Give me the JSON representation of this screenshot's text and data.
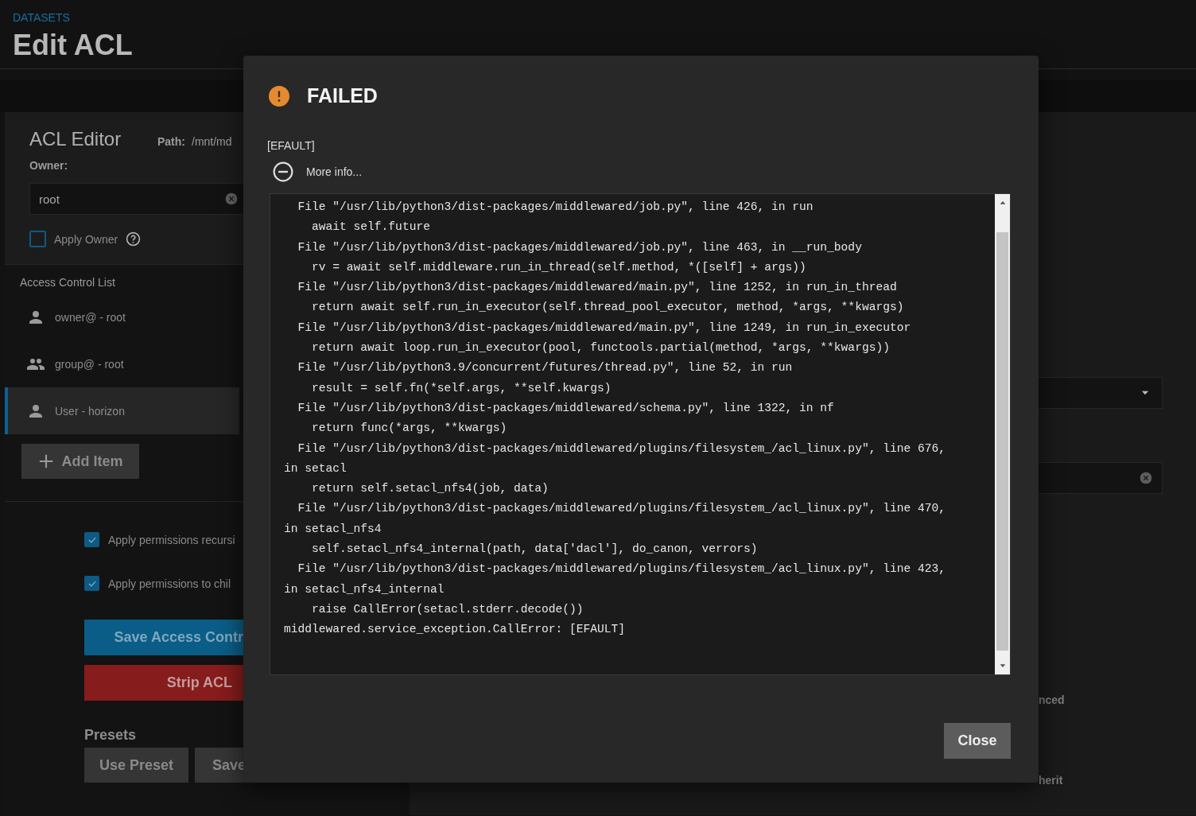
{
  "breadcrumb": "DATASETS",
  "page_title": "Edit ACL",
  "acl_editor": {
    "title": "ACL Editor",
    "path_label": "Path:",
    "path_value": "/mnt/md",
    "owner_label": "Owner:",
    "owner_field": {
      "value": "root"
    },
    "apply_owner": {
      "label": "Apply Owner",
      "checked": false
    }
  },
  "access_control_list": {
    "title": "Access Control List",
    "items": [
      {
        "kind": "user",
        "label": "owner@ - root",
        "selected": false
      },
      {
        "kind": "group",
        "label": "group@ - root",
        "selected": false
      },
      {
        "kind": "user",
        "label": "User - horizon",
        "selected": true
      }
    ],
    "add_button": "Add Item"
  },
  "options": [
    {
      "label": "Apply permissions recursi",
      "checked": true
    },
    {
      "label": "Apply permissions to chil",
      "checked": true
    }
  ],
  "actions": [
    {
      "kind": "primary",
      "label": "Save Access Contr"
    },
    {
      "kind": "danger",
      "label": "Strip ACL"
    }
  ],
  "presets": {
    "title": "Presets",
    "buttons": [
      "Use Preset",
      "Save"
    ]
  },
  "right_panel": {
    "texts": [
      "nced",
      "herit"
    ]
  },
  "dialog": {
    "title": "FAILED",
    "message": "[EFAULT]",
    "more_info": {
      "label": "More info...",
      "expanded": true
    },
    "traceback": [
      "  File \"/usr/lib/python3/dist-packages/middlewared/job.py\", line 426, in run",
      "    await self.future",
      "  File \"/usr/lib/python3/dist-packages/middlewared/job.py\", line 463, in __run_body",
      "    rv = await self.middleware.run_in_thread(self.method, *([self] + args))",
      "  File \"/usr/lib/python3/dist-packages/middlewared/main.py\", line 1252, in run_in_thread",
      "    return await self.run_in_executor(self.thread_pool_executor, method, *args, **kwargs)",
      "  File \"/usr/lib/python3/dist-packages/middlewared/main.py\", line 1249, in run_in_executor",
      "    return await loop.run_in_executor(pool, functools.partial(method, *args, **kwargs))",
      "  File \"/usr/lib/python3.9/concurrent/futures/thread.py\", line 52, in run",
      "    result = self.fn(*self.args, **self.kwargs)",
      "  File \"/usr/lib/python3/dist-packages/middlewared/schema.py\", line 1322, in nf",
      "    return func(*args, **kwargs)",
      "  File \"/usr/lib/python3/dist-packages/middlewared/plugins/filesystem_/acl_linux.py\", line 676, in setacl",
      "    return self.setacl_nfs4(job, data)",
      "  File \"/usr/lib/python3/dist-packages/middlewared/plugins/filesystem_/acl_linux.py\", line 470, in setacl_nfs4",
      "    self.setacl_nfs4_internal(path, data['dacl'], do_canon, verrors)",
      "  File \"/usr/lib/python3/dist-packages/middlewared/plugins/filesystem_/acl_linux.py\", line 423, in setacl_nfs4_internal",
      "    raise CallError(setacl.stderr.decode())",
      "middlewared.service_exception.CallError: [EFAULT]"
    ],
    "close_button": "Close"
  }
}
